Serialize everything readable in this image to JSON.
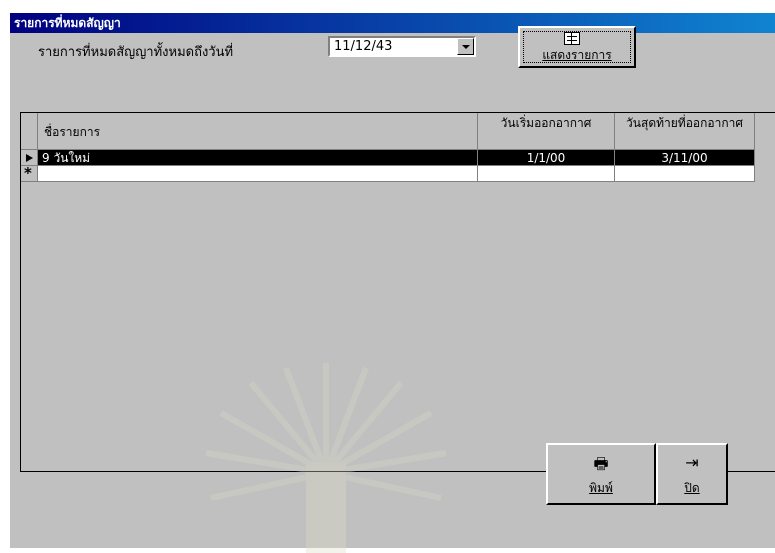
{
  "window": {
    "title": "รายการที่หมดสัญญา"
  },
  "filter": {
    "label": "รายการที่หมดสัญญาทั้งหมดถึงวันที่",
    "date_value": "11/12/43"
  },
  "show_button": {
    "label": "แสดงรายการ",
    "icon": "book-icon"
  },
  "grid": {
    "columns": [
      {
        "label": "ชื่อรายการ"
      },
      {
        "label": "วันเริ่มออกอากาศ"
      },
      {
        "label": "วันสุดท้ายที่ออกอากาศ"
      }
    ],
    "rows": [
      {
        "name": "9 วันใหม่",
        "start": "1/1/00",
        "end": "3/11/00"
      }
    ],
    "new_row_marker": "*"
  },
  "footer": {
    "print_label": "พิมพ์",
    "close_label": "ปิด"
  },
  "colors": {
    "titlebar": "#000080",
    "face": "#c0c0c0",
    "selection": "#000000"
  }
}
